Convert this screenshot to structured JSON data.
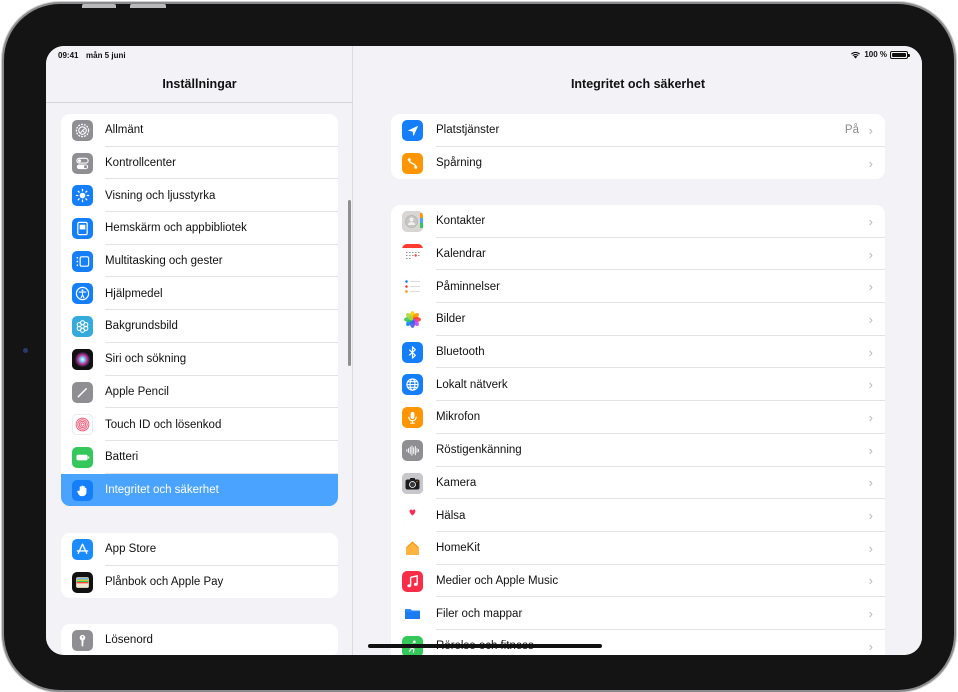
{
  "status_bar": {
    "time": "09:41",
    "date": "mån 5 juni",
    "battery": "100 %"
  },
  "sidebar": {
    "title": "Inställningar",
    "groups": [
      {
        "items": [
          {
            "label": "Allmänt",
            "icon": "gear-icon",
            "color": "#8e8e93"
          },
          {
            "label": "Kontrollcenter",
            "icon": "toggles-icon",
            "color": "#8e8e93"
          },
          {
            "label": "Visning och ljusstyrka",
            "icon": "sun-icon",
            "color": "#147efb"
          },
          {
            "label": "Hemskärm och appbibliotek",
            "icon": "home-screen-icon",
            "color": "#147efb"
          },
          {
            "label": "Multitasking och gester",
            "icon": "multitasking-icon",
            "color": "#147efb"
          },
          {
            "label": "Hjälpmedel",
            "icon": "accessibility-icon",
            "color": "#147efb"
          },
          {
            "label": "Bakgrundsbild",
            "icon": "wallpaper-flower-icon",
            "color": "#35aadc"
          },
          {
            "label": "Siri och sökning",
            "icon": "siri-icon",
            "color": "#222222"
          },
          {
            "label": "Apple Pencil",
            "icon": "pencil-icon",
            "color": "#8e8e93"
          },
          {
            "label": "Touch ID och lösenkod",
            "icon": "fingerprint-icon",
            "color": "#ffffff"
          },
          {
            "label": "Batteri",
            "icon": "battery-icon",
            "color": "#34c759"
          },
          {
            "label": "Integritet och säkerhet",
            "icon": "hand-icon",
            "color": "#147efb",
            "selected": true
          }
        ]
      },
      {
        "items": [
          {
            "label": "App Store",
            "icon": "app-store-icon",
            "color": "#1a8cff"
          },
          {
            "label": "Plånbok och Apple Pay",
            "icon": "wallet-icon",
            "color": "#111111"
          }
        ]
      },
      {
        "items": [
          {
            "label": "Lösenord",
            "icon": "key-icon",
            "color": "#8e8e93"
          }
        ]
      }
    ]
  },
  "detail": {
    "title": "Integritet och säkerhet",
    "groups": [
      {
        "items": [
          {
            "label": "Platstjänster",
            "icon": "location-arrow-icon",
            "color": "#147efb",
            "value": "På"
          },
          {
            "label": "Spårning",
            "icon": "tracking-icon",
            "color": "#ff9500"
          }
        ]
      },
      {
        "items": [
          {
            "label": "Kontakter",
            "icon": "contacts-icon",
            "color": "#d8d6d2"
          },
          {
            "label": "Kalendrar",
            "icon": "calendar-icon",
            "color": "#ffffff"
          },
          {
            "label": "Påminnelser",
            "icon": "reminders-icon",
            "color": "#ffffff"
          },
          {
            "label": "Bilder",
            "icon": "photos-icon",
            "color": "#ffffff"
          },
          {
            "label": "Bluetooth",
            "icon": "bluetooth-icon",
            "color": "#147efb"
          },
          {
            "label": "Lokalt nätverk",
            "icon": "globe-icon",
            "color": "#147efb"
          },
          {
            "label": "Mikrofon",
            "icon": "microphone-icon",
            "color": "#ff9500"
          },
          {
            "label": "Röstigenkänning",
            "icon": "waveform-icon",
            "color": "#8e8e93"
          },
          {
            "label": "Kamera",
            "icon": "camera-icon",
            "color": "#8e8e93"
          },
          {
            "label": "Hälsa",
            "icon": "heart-icon",
            "color": "#ffffff"
          },
          {
            "label": "HomeKit",
            "icon": "house-icon",
            "color": "#ffffff"
          },
          {
            "label": "Medier och Apple Music",
            "icon": "music-note-icon",
            "color": "#fa2d48"
          },
          {
            "label": "Filer och mappar",
            "icon": "folder-icon",
            "color": "#ffffff"
          },
          {
            "label": "Rörelse och fitness",
            "icon": "running-icon",
            "color": "#34c759"
          }
        ]
      }
    ]
  },
  "colors": {
    "accent": "#147efb",
    "selection": "#4aa3ff",
    "background": "#f2f2f7"
  }
}
